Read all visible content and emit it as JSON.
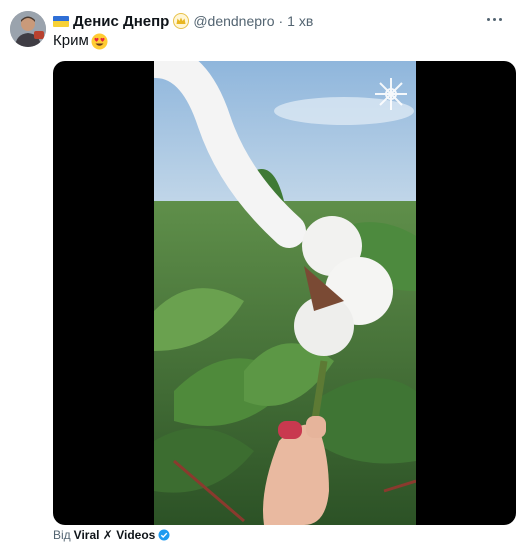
{
  "tweet": {
    "author": {
      "display_name": "Денис Днепр",
      "handle": "@dendnepro",
      "flag_icon": "ukraine-flag-icon",
      "badge_icon": "crown-badge-icon",
      "avatar_icon": "user-avatar"
    },
    "separator": "·",
    "time": "1 хв",
    "text": "Крим",
    "text_emoji_icon": "heart-eyes-emoji-icon",
    "media": {
      "type": "video",
      "watermark_icon": "snowflake-watermark-icon"
    },
    "footer": {
      "via_label": "Від",
      "source": "Viral ✗ Videos",
      "verified_icon": "verified-badge-icon"
    }
  },
  "colors": {
    "text_primary": "#0f1419",
    "text_secondary": "#536471",
    "flag_blue": "#2f6fd6",
    "flag_yellow": "#f7d136",
    "verified_blue": "#1d9bf0"
  }
}
